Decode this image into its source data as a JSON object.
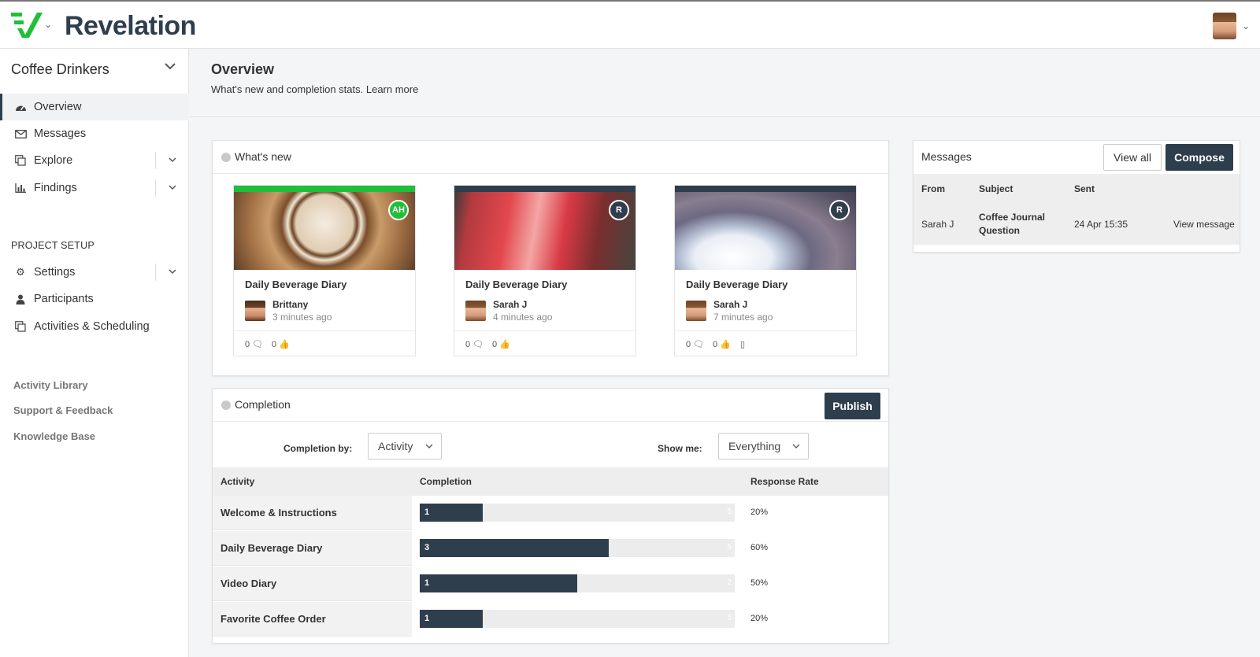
{
  "app": {
    "name": "Revelation"
  },
  "sidebar": {
    "project": "Coffee Drinkers",
    "items": [
      {
        "label": "Overview",
        "icon": "dashboard-icon"
      },
      {
        "label": "Messages",
        "icon": "envelope-icon"
      },
      {
        "label": "Explore",
        "icon": "copy-icon"
      },
      {
        "label": "Findings",
        "icon": "bar-chart-icon"
      }
    ],
    "setup_label": "PROJECT SETUP",
    "setup_items": [
      {
        "label": "Settings",
        "icon": "gear-icon"
      },
      {
        "label": "Participants",
        "icon": "user-icon"
      },
      {
        "label": "Activities & Scheduling",
        "icon": "copy-icon"
      }
    ],
    "footer_links": [
      "Activity Library",
      "Support & Feedback",
      "Knowledge Base"
    ]
  },
  "page": {
    "title": "Overview",
    "subtitle": "What's new and completion stats. Learn more"
  },
  "whats_new": {
    "title": "What's new",
    "cards": [
      {
        "title": "Daily Beverage Diary",
        "user": "Brittany",
        "time": "3 minutes ago",
        "badge": "AH",
        "comments": "0",
        "likes": "0",
        "bar_color": "#1fbf3a",
        "badge_color": "#1fbf3a"
      },
      {
        "title": "Daily Beverage Diary",
        "user": "Sarah J",
        "time": "4 minutes ago",
        "badge": "R",
        "comments": "0",
        "likes": "0",
        "bar_color": "#2f3e4d",
        "badge_color": "#2f3e4d"
      },
      {
        "title": "Daily Beverage Diary",
        "user": "Sarah J",
        "time": "7 minutes ago",
        "badge": "R",
        "comments": "0",
        "likes": "0",
        "bar_color": "#2f3e4d",
        "badge_color": "#2f3e4d"
      }
    ]
  },
  "completion": {
    "title": "Completion",
    "publish_label": "Publish",
    "by_label": "Completion by:",
    "by_value": "Activity",
    "show_label": "Show me:",
    "show_value": "Everything",
    "headers": [
      "Activity",
      "Completion",
      "Response Rate"
    ],
    "rows": [
      {
        "activity": "Welcome & Instructions",
        "done": 1,
        "total": 5,
        "rate": "20%"
      },
      {
        "activity": "Daily Beverage Diary",
        "done": 3,
        "total": 5,
        "rate": "60%"
      },
      {
        "activity": "Video Diary",
        "done": 1,
        "total": 2,
        "rate": "50%"
      },
      {
        "activity": "Favorite Coffee Order",
        "done": 1,
        "total": 5,
        "rate": "20%"
      }
    ]
  },
  "messages": {
    "title": "Messages",
    "view_all": "View all",
    "compose": "Compose",
    "headers": [
      "From",
      "Subject",
      "Sent"
    ],
    "rows": [
      {
        "from": "Sarah J",
        "subject_1": "Coffee Journal",
        "subject_2": "Question",
        "sent": "24 Apr 15:35",
        "action": "View message"
      }
    ]
  },
  "colors": {
    "brand": "#2f3e4d",
    "accent": "#1fbf3a"
  }
}
